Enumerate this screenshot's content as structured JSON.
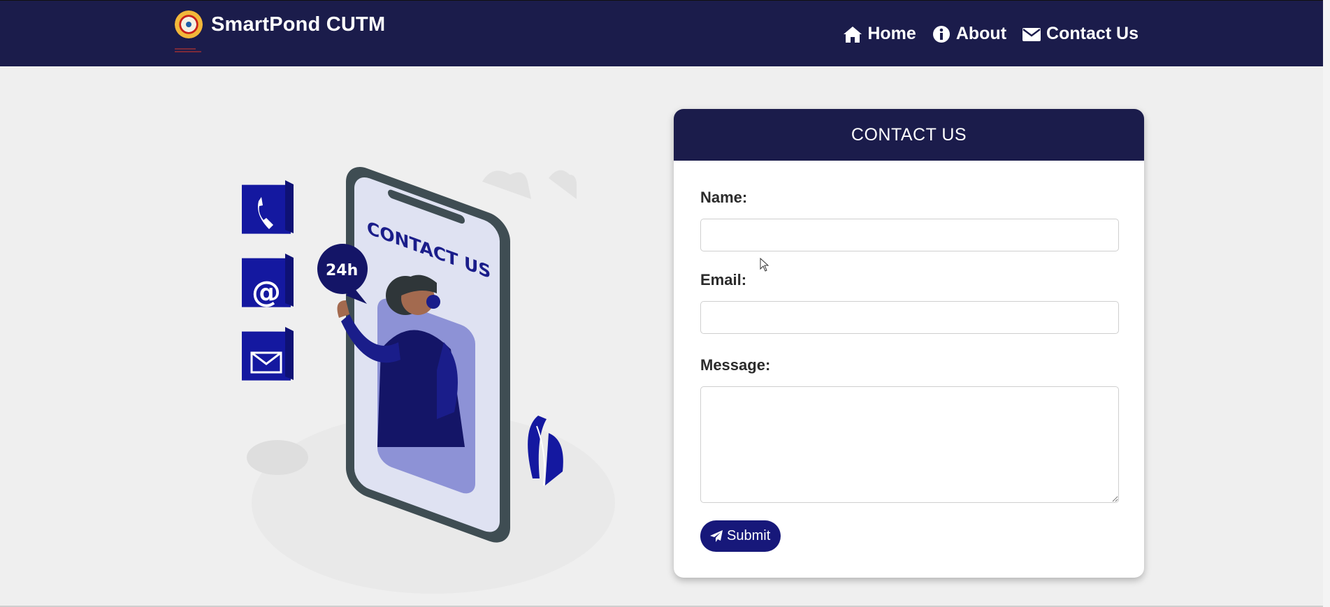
{
  "navbar": {
    "brand_title": "SmartPond CUTM",
    "links": [
      {
        "label": "Home",
        "icon": "home-icon"
      },
      {
        "label": "About",
        "icon": "info-icon"
      },
      {
        "label": "Contact Us",
        "icon": "envelope-icon"
      }
    ]
  },
  "illustration": {
    "screen_title": "CONTACT US",
    "badge": "24h",
    "icons": [
      "phone-icon",
      "at-icon",
      "mail-icon"
    ]
  },
  "contact_form": {
    "header": "CONTACT US",
    "name_label": "Name:",
    "name_value": "",
    "email_label": "Email:",
    "email_value": "",
    "message_label": "Message:",
    "message_value": "",
    "submit_label": "Submit"
  },
  "colors": {
    "navbar_bg": "#1b1c4b",
    "accent": "#17187a",
    "page_bg": "#efefef"
  }
}
